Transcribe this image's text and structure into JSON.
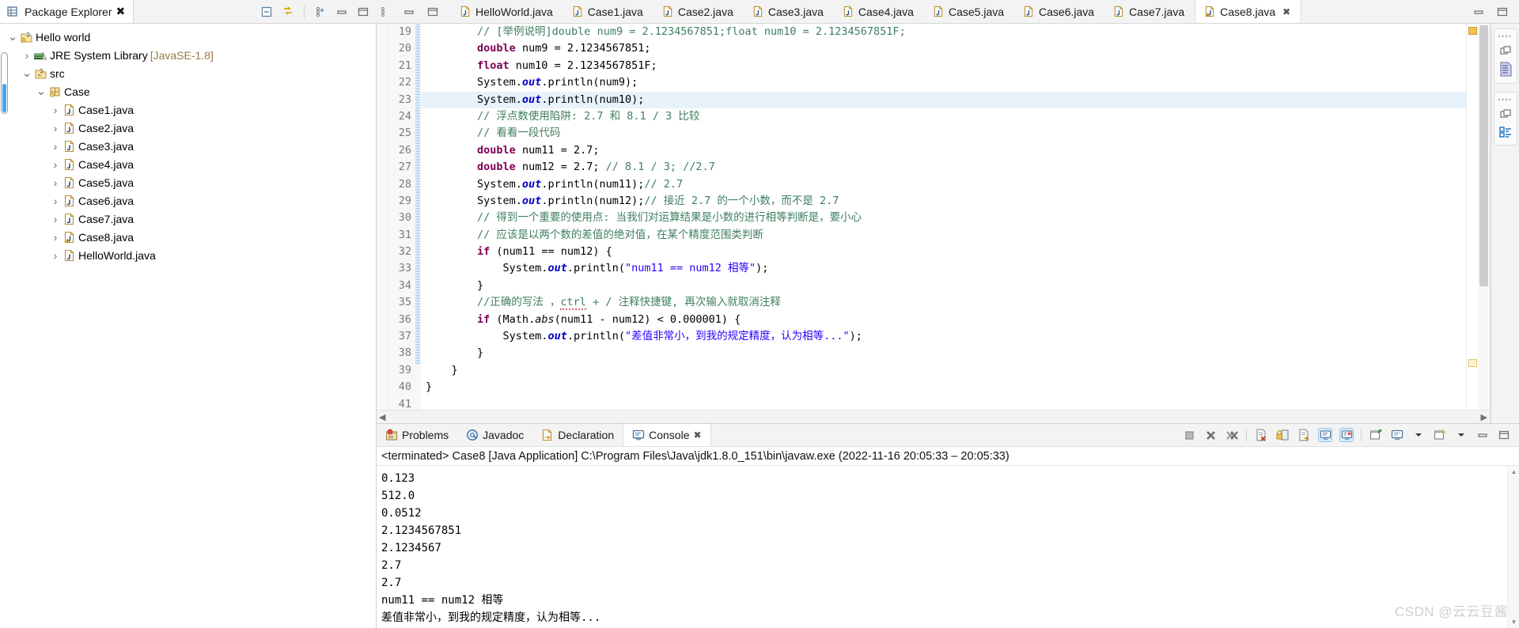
{
  "explorer": {
    "tab_label": "Package Explorer",
    "close_icon": "close-icon",
    "actions": [
      "collapse-all-icon",
      "link-with-editor-icon",
      "view-menu-icon",
      "minimize-icon",
      "maximize-icon"
    ],
    "tree": [
      {
        "indent": 0,
        "arrow": "v",
        "icon": "java-project-icon",
        "label": "Hello world",
        "suffix": ""
      },
      {
        "indent": 1,
        "arrow": ">",
        "icon": "library-icon",
        "label": "JRE System Library",
        "suffix": "[JavaSE-1.8]"
      },
      {
        "indent": 1,
        "arrow": "v",
        "icon": "source-folder-icon",
        "label": "src",
        "suffix": ""
      },
      {
        "indent": 2,
        "arrow": "v",
        "icon": "package-icon",
        "label": "Case",
        "suffix": ""
      },
      {
        "indent": 3,
        "arrow": ">",
        "icon": "java-file-icon",
        "label": "Case1.java",
        "suffix": ""
      },
      {
        "indent": 3,
        "arrow": ">",
        "icon": "java-file-icon",
        "label": "Case2.java",
        "suffix": ""
      },
      {
        "indent": 3,
        "arrow": ">",
        "icon": "java-file-icon",
        "label": "Case3.java",
        "suffix": ""
      },
      {
        "indent": 3,
        "arrow": ">",
        "icon": "java-file-icon",
        "label": "Case4.java",
        "suffix": ""
      },
      {
        "indent": 3,
        "arrow": ">",
        "icon": "java-file-icon",
        "label": "Case5.java",
        "suffix": ""
      },
      {
        "indent": 3,
        "arrow": ">",
        "icon": "java-file-icon",
        "label": "Case6.java",
        "suffix": ""
      },
      {
        "indent": 3,
        "arrow": ">",
        "icon": "java-file-icon",
        "label": "Case7.java",
        "suffix": ""
      },
      {
        "indent": 3,
        "arrow": ">",
        "icon": "java-file-warning-icon",
        "label": "Case8.java",
        "suffix": ""
      },
      {
        "indent": 3,
        "arrow": ">",
        "icon": "java-file-icon",
        "label": "HelloWorld.java",
        "suffix": ""
      }
    ]
  },
  "editor": {
    "tabs": [
      {
        "label": "HelloWorld.java",
        "active": false,
        "warning": false
      },
      {
        "label": "Case1.java",
        "active": false,
        "warning": false
      },
      {
        "label": "Case2.java",
        "active": false,
        "warning": false
      },
      {
        "label": "Case3.java",
        "active": false,
        "warning": false
      },
      {
        "label": "Case4.java",
        "active": false,
        "warning": false
      },
      {
        "label": "Case5.java",
        "active": false,
        "warning": false
      },
      {
        "label": "Case6.java",
        "active": false,
        "warning": false
      },
      {
        "label": "Case7.java",
        "active": false,
        "warning": false
      },
      {
        "label": "Case8.java",
        "active": true,
        "warning": true
      }
    ],
    "active_tab_close": "close-icon",
    "first_line_number": 19,
    "lines": [
      {
        "n": 19,
        "text": "        // [举例说明]double num9 = 2.1234567851;float num10 = 2.1234567851F;",
        "highlight": false
      },
      {
        "n": 20,
        "text": "        double num9 = 2.1234567851;",
        "highlight": false
      },
      {
        "n": 21,
        "text": "        float num10 = 2.1234567851F;",
        "highlight": false
      },
      {
        "n": 22,
        "text": "        System.out.println(num9);",
        "highlight": false
      },
      {
        "n": 23,
        "text": "        System.out.println(num10);",
        "highlight": true
      },
      {
        "n": 24,
        "text": "        // 浮点数使用陷阱: 2.7 和 8.1 / 3 比较",
        "highlight": false
      },
      {
        "n": 25,
        "text": "        // 看看一段代码",
        "highlight": false
      },
      {
        "n": 26,
        "text": "        double num11 = 2.7;",
        "highlight": false
      },
      {
        "n": 27,
        "text": "        double num12 = 2.7; // 8.1 / 3; //2.7",
        "highlight": false
      },
      {
        "n": 28,
        "text": "        System.out.println(num11);// 2.7",
        "highlight": false
      },
      {
        "n": 29,
        "text": "        System.out.println(num12);// 接近 2.7 的一个小数，而不是 2.7",
        "highlight": false
      },
      {
        "n": 30,
        "text": "        // 得到一个重要的使用点: 当我们对运算结果是小数的进行相等判断是，要小心",
        "highlight": false
      },
      {
        "n": 31,
        "text": "        // 应该是以两个数的差值的绝对值，在某个精度范围类判断",
        "highlight": false
      },
      {
        "n": 32,
        "text": "        if (num11 == num12) {",
        "highlight": false
      },
      {
        "n": 33,
        "text": "            System.out.println(\"num11 == num12 相等\");",
        "highlight": false
      },
      {
        "n": 34,
        "text": "        }",
        "highlight": false
      },
      {
        "n": 35,
        "text": "        //正确的写法 ，ctrl + / 注释快捷键, 再次输入就取消注释",
        "highlight": false
      },
      {
        "n": 36,
        "text": "        if (Math.abs(num11 - num12) < 0.000001) {",
        "highlight": false
      },
      {
        "n": 37,
        "text": "            System.out.println(\"差值非常小，到我的规定精度，认为相等...\");",
        "highlight": false
      },
      {
        "n": 38,
        "text": "        }",
        "highlight": false
      },
      {
        "n": 39,
        "text": "    }",
        "highlight": false
      },
      {
        "n": 40,
        "text": "}",
        "highlight": false
      },
      {
        "n": 41,
        "text": "",
        "highlight": false
      }
    ]
  },
  "bottom_panel": {
    "tabs": [
      {
        "label": "Problems",
        "icon": "problems-icon",
        "active": false
      },
      {
        "label": "Javadoc",
        "icon": "javadoc-icon",
        "active": false
      },
      {
        "label": "Declaration",
        "icon": "declaration-icon",
        "active": false
      },
      {
        "label": "Console",
        "icon": "console-icon",
        "active": true
      }
    ],
    "active_close_icon": "close-icon",
    "tools": [
      "terminate-icon",
      "remove-launch-icon",
      "remove-all-terminated-icon",
      "clear-console-icon",
      "scroll-lock-icon",
      "word-wrap-icon",
      "show-console-on-output-icon",
      "show-console-on-error-icon",
      "pin-console-icon",
      "display-selected-console-icon",
      "display-selected-console-menu-icon",
      "open-console-icon",
      "open-console-menu-icon",
      "minimize-icon",
      "maximize-icon"
    ],
    "console_header": "<terminated> Case8 [Java Application] C:\\Program Files\\Java\\jdk1.8.0_151\\bin\\javaw.exe  (2022-11-16 20:05:33 – 20:05:33)",
    "console_output": [
      "0.123",
      "512.0",
      "0.0512",
      "2.1234567851",
      "2.1234567",
      "2.7",
      "2.7",
      "num11 == num12 相等",
      "差值非常小，到我的规定精度，认为相等..."
    ]
  },
  "watermark": "CSDN @云云豆酱",
  "colors": {
    "keyword": "#7f0055",
    "comment": "#3f7f5f",
    "string": "#2a00ff",
    "field": "#0000c0",
    "selection": "#e8f2fb",
    "accent": "#4aa3e8"
  }
}
